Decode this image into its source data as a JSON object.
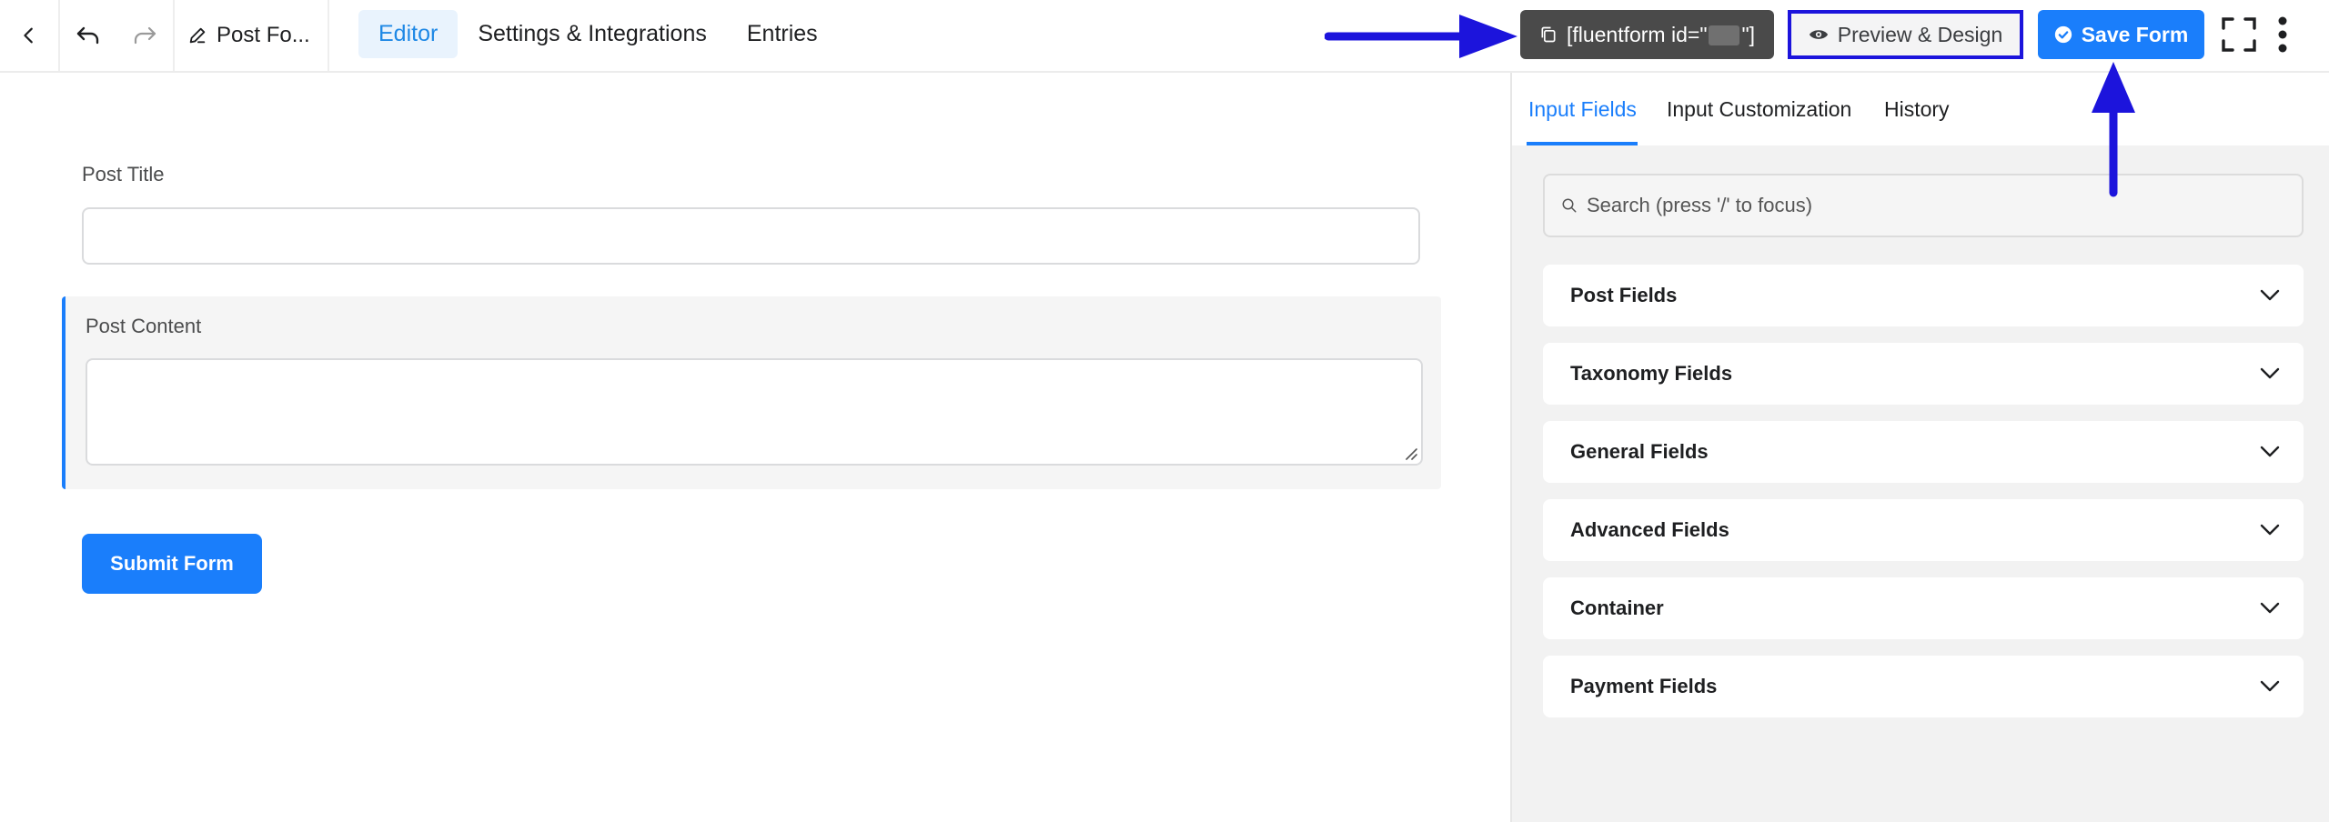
{
  "toolbar": {
    "form_name": "Post Fo...",
    "tabs": [
      {
        "label": "Editor",
        "active": true
      },
      {
        "label": "Settings & Integrations",
        "active": false
      },
      {
        "label": "Entries",
        "active": false
      }
    ],
    "shortcode_prefix": "[fluentform id=\"",
    "shortcode_suffix": "\"]",
    "preview_label": "Preview & Design",
    "save_label": "Save Form"
  },
  "form": {
    "post_title_label": "Post Title",
    "post_content_label": "Post Content",
    "submit_label": "Submit Form"
  },
  "sidebar": {
    "tabs": [
      {
        "label": "Input Fields",
        "active": true
      },
      {
        "label": "Input Customization",
        "active": false
      },
      {
        "label": "History",
        "active": false
      }
    ],
    "search_placeholder": "Search (press '/' to focus)",
    "sections": [
      {
        "label": "Post Fields"
      },
      {
        "label": "Taxonomy Fields"
      },
      {
        "label": "General Fields"
      },
      {
        "label": "Advanced Fields"
      },
      {
        "label": "Container"
      },
      {
        "label": "Payment Fields"
      }
    ]
  },
  "colors": {
    "accent": "#1a7efb",
    "annotation": "#1c14dc",
    "shortcode_bg": "#4a4a4a"
  }
}
